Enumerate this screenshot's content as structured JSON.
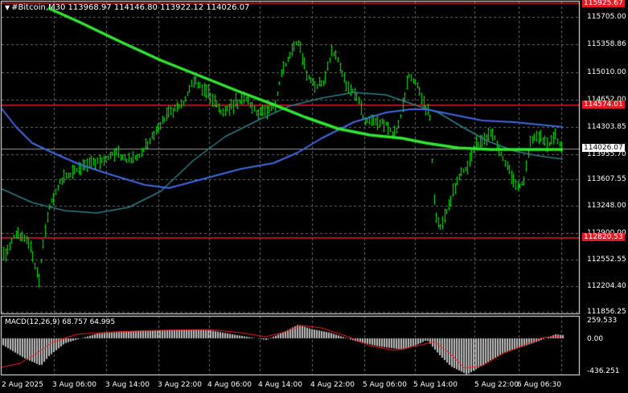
{
  "header": {
    "symbol": "#Bitcoin,M30",
    "open": "113968.97",
    "high": "114146.80",
    "low": "113922.12",
    "close": "114026.07"
  },
  "macd": {
    "label": "MACD(12,26,9) 68.757 64.995",
    "levels": [
      "259.533",
      "0.00",
      "-436.251"
    ]
  },
  "price_axis": {
    "ticks": [
      "115705.00",
      "115358.86",
      "115010.00",
      "114652.00",
      "114303.85",
      "113955.70",
      "113607.55",
      "113248.00",
      "112900.00",
      "112552.55",
      "112204.40",
      "111856.25"
    ],
    "tags": {
      "resistance_top": "115925.67",
      "resistance_mid": "114574.01",
      "support": "112820.53",
      "current": "114026.07"
    }
  },
  "time_axis": {
    "labels": [
      "2 Aug 2025",
      "3 Aug 06:00",
      "3 Aug 14:00",
      "3 Aug 22:00",
      "4 Aug 06:00",
      "4 Aug 14:00",
      "4 Aug 22:00",
      "5 Aug 06:00",
      "5 Aug 14:00",
      "5 Aug 22:00",
      "6 Aug 06:30"
    ]
  },
  "colors": {
    "background": "#000000",
    "candles": "#00e600",
    "grid": "#6a6a6a",
    "level_lines": "#e51c23",
    "ma_fast": "#2e7d86",
    "ma_medium": "#4169e1",
    "ma_slow": "#32e632",
    "macd_histogram": "#c0c0c0",
    "macd_signal": "#ff2020"
  }
}
